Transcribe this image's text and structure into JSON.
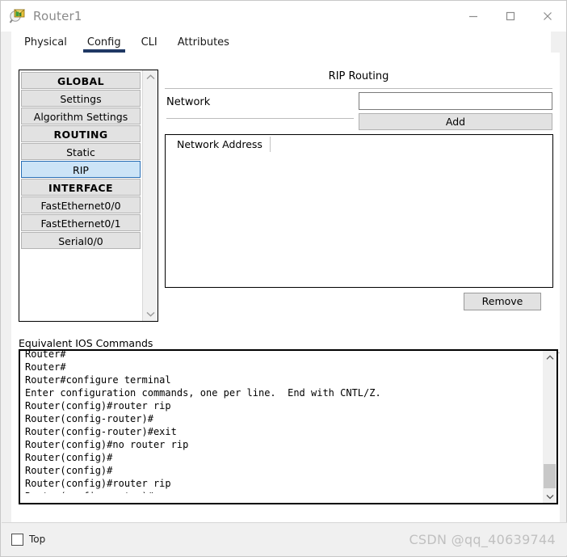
{
  "window": {
    "title": "Router1",
    "icon": "packet-tracer-magnifier-icon",
    "controls": {
      "minimize": "minimize-icon",
      "maximize": "maximize-icon",
      "close": "close-icon"
    }
  },
  "tabs": [
    {
      "label": "Physical",
      "active": false
    },
    {
      "label": "Config",
      "active": true
    },
    {
      "label": "CLI",
      "active": false
    },
    {
      "label": "Attributes",
      "active": false
    }
  ],
  "sidebar": {
    "items": [
      {
        "label": "GLOBAL",
        "type": "header"
      },
      {
        "label": "Settings",
        "type": "item"
      },
      {
        "label": "Algorithm Settings",
        "type": "item"
      },
      {
        "label": "ROUTING",
        "type": "header"
      },
      {
        "label": "Static",
        "type": "item"
      },
      {
        "label": "RIP",
        "type": "item",
        "selected": true
      },
      {
        "label": "INTERFACE",
        "type": "header"
      },
      {
        "label": "FastEthernet0/0",
        "type": "item"
      },
      {
        "label": "FastEthernet0/1",
        "type": "item"
      },
      {
        "label": "Serial0/0",
        "type": "item"
      }
    ],
    "scroll_up": "chevron-up-icon",
    "scroll_down": "chevron-down-icon"
  },
  "rip": {
    "title": "RIP Routing",
    "network_label": "Network",
    "network_value": "",
    "network_placeholder": "",
    "add_label": "Add",
    "remove_label": "Remove",
    "table": {
      "columns": [
        "Network Address"
      ],
      "rows": []
    }
  },
  "ios": {
    "label": "Equivalent IOS Commands",
    "lines": [
      "Router#",
      "Router#",
      "Router#configure terminal",
      "Enter configuration commands, one per line.  End with CNTL/Z.",
      "Router(config)#router rip",
      "Router(config-router)#",
      "Router(config-router)#exit",
      "Router(config)#no router rip",
      "Router(config)#",
      "Router(config)#",
      "Router(config)#router rip",
      "Router(config-router)#"
    ],
    "scroll_up": "chevron-up-icon",
    "scroll_down": "chevron-down-icon"
  },
  "footer": {
    "top_label": "Top",
    "top_checked": false,
    "watermark": "CSDN @qq_40639744"
  },
  "colors": {
    "accent": "#1f3864",
    "selection": "#cce4f7",
    "selection_border": "#2a6fb5",
    "button_face": "#e2e2e2",
    "window_bg": "#f0f0f0"
  }
}
